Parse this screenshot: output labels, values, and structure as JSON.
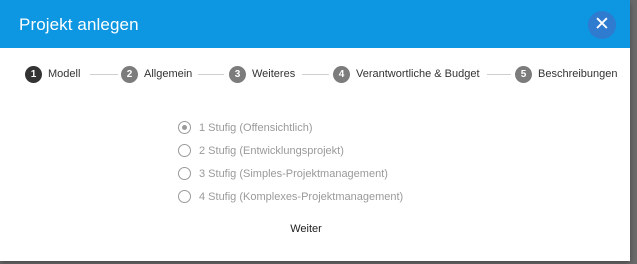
{
  "dialog": {
    "title": "Projekt anlegen",
    "close_symbol": "✕"
  },
  "steps": [
    {
      "number": "1",
      "label": "Modell",
      "active": true
    },
    {
      "number": "2",
      "label": "Allgemein",
      "active": false
    },
    {
      "number": "3",
      "label": "Weiteres",
      "active": false
    },
    {
      "number": "4",
      "label": "Verantwortliche & Budget",
      "active": false
    },
    {
      "number": "5",
      "label": "Beschreibungen",
      "active": false
    }
  ],
  "options": [
    {
      "label": "1 Stufig (Offensichtlich)",
      "checked": true
    },
    {
      "label": "2 Stufig (Entwicklungsprojekt)",
      "checked": false
    },
    {
      "label": "3 Stufig (Simples-Projektmanagement)",
      "checked": false
    },
    {
      "label": "4 Stufig (Komplexes-Projektmanagement)",
      "checked": false
    }
  ],
  "actions": {
    "next_label": "Weiter"
  },
  "colors": {
    "header": "#0d96e1",
    "close_button": "#2e7bd0",
    "active_step": "#333333",
    "inactive_step": "#7c7c7c"
  }
}
